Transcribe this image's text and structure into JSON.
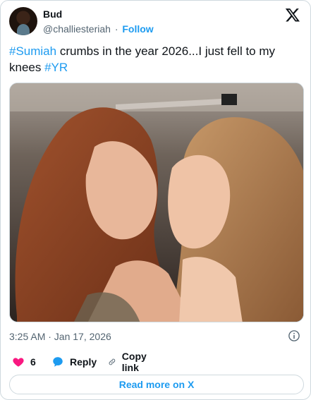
{
  "author": {
    "name": "Bud",
    "handle": "@challiesteriah",
    "separator": "·",
    "follow_label": "Follow"
  },
  "tweet": {
    "hashtag1": "#Sumiah",
    "text_mid": " crumbs in the year 2026...I just fell to my knees ",
    "hashtag2": "#YR"
  },
  "meta": {
    "timestamp": "3:25 AM · Jan 17, 2026"
  },
  "actions": {
    "like_count": "6",
    "reply_label": "Reply",
    "copy_link_label": "Copy link"
  },
  "read_more_label": "Read more on X",
  "colors": {
    "accent": "#1d9bf0",
    "like": "#f91880",
    "text": "#0f1419",
    "muted": "#536471"
  },
  "icons": [
    "x-logo-icon",
    "info-icon",
    "heart-icon",
    "reply-bubble-icon",
    "link-icon"
  ]
}
